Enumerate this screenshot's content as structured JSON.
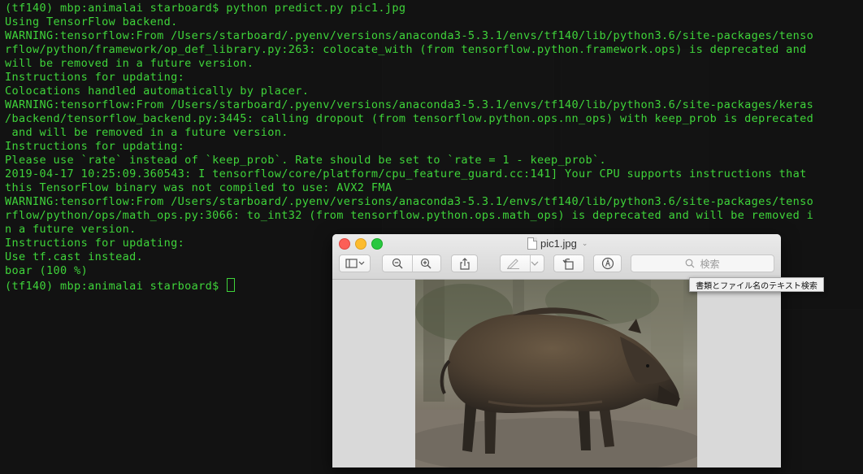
{
  "terminal": {
    "lines": [
      "(tf140) mbp:animalai starboard$ python predict.py pic1.jpg",
      "Using TensorFlow backend.",
      "WARNING:tensorflow:From /Users/starboard/.pyenv/versions/anaconda3-5.3.1/envs/tf140/lib/python3.6/site-packages/tenso",
      "rflow/python/framework/op_def_library.py:263: colocate_with (from tensorflow.python.framework.ops) is deprecated and",
      "will be removed in a future version.",
      "Instructions for updating:",
      "Colocations handled automatically by placer.",
      "WARNING:tensorflow:From /Users/starboard/.pyenv/versions/anaconda3-5.3.1/envs/tf140/lib/python3.6/site-packages/keras",
      "/backend/tensorflow_backend.py:3445: calling dropout (from tensorflow.python.ops.nn_ops) with keep_prob is deprecated",
      " and will be removed in a future version.",
      "Instructions for updating:",
      "Please use `rate` instead of `keep_prob`. Rate should be set to `rate = 1 - keep_prob`.",
      "2019-04-17 10:25:09.360543: I tensorflow/core/platform/cpu_feature_guard.cc:141] Your CPU supports instructions that",
      "this TensorFlow binary was not compiled to use: AVX2 FMA",
      "WARNING:tensorflow:From /Users/starboard/.pyenv/versions/anaconda3-5.3.1/envs/tf140/lib/python3.6/site-packages/tenso",
      "rflow/python/ops/math_ops.py:3066: to_int32 (from tensorflow.python.ops.math_ops) is deprecated and will be removed i",
      "n a future version.",
      "Instructions for updating:",
      "Use tf.cast instead.",
      "boar (100 %)"
    ],
    "prompt": "(tf140) mbp:animalai starboard$ ",
    "text_color": "#3fd43a",
    "background_color": "#121212"
  },
  "preview": {
    "title": "pic1.jpg",
    "search_placeholder": "検索",
    "tooltip": "書類とファイル名のテキスト検索",
    "icons": {
      "sidebar": "sidebar-toggle-icon",
      "zoom_out": "zoom-out-icon",
      "zoom_in": "zoom-in-icon",
      "share": "share-icon",
      "markup": "markup-pen-icon",
      "rotate": "rotate-left-icon",
      "annotate": "annotate-icon",
      "search": "search-icon"
    },
    "traffic_light_colors": [
      "#fc5f57",
      "#fdbc2e",
      "#29c840"
    ]
  }
}
